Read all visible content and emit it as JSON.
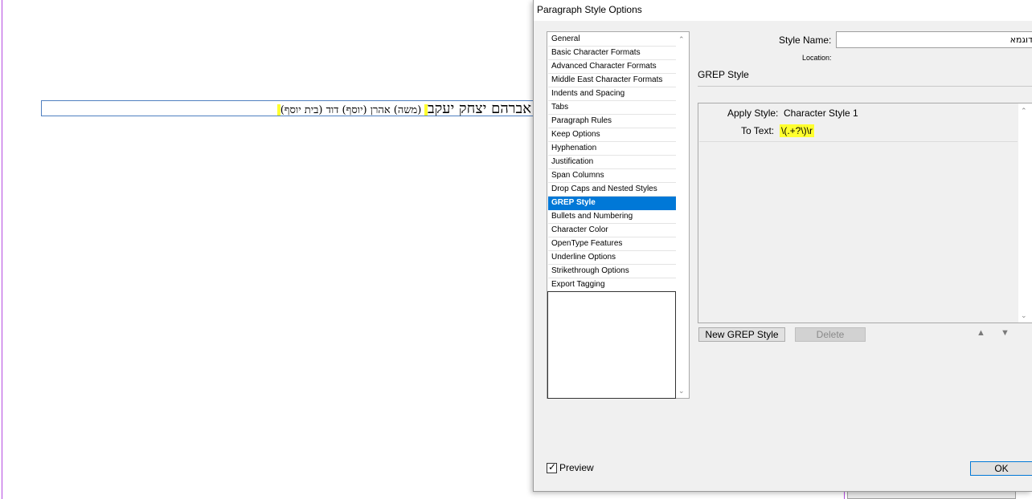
{
  "document": {
    "line_part1": "אברהם יצחק יעקב",
    "line_part2": "(משה) אהרן (יוסף) דוד (בית יוסף)"
  },
  "dialog": {
    "title": "Paragraph Style Options",
    "categories": [
      "General",
      "Basic Character Formats",
      "Advanced Character Formats",
      "Middle East Character Formats",
      "Indents and Spacing",
      "Tabs",
      "Paragraph Rules",
      "Keep Options",
      "Hyphenation",
      "Justification",
      "Span Columns",
      "Drop Caps and Nested Styles",
      "GREP Style",
      "Bullets and Numbering",
      "Character Color",
      "OpenType Features",
      "Underline Options",
      "Strikethrough Options",
      "Export Tagging"
    ],
    "selected_category": "GREP Style",
    "style_name_label": "Style Name:",
    "style_name_value": "דוגמא",
    "location_label": "Location:",
    "section_title": "GREP Style",
    "grep": {
      "apply_style_label": "Apply Style:",
      "apply_style_value": "Character Style 1",
      "to_text_label": "To Text:",
      "to_text_value": "\\(.+?\\)\\r"
    },
    "buttons": {
      "new_grep_style": "New GREP Style",
      "delete": "Delete",
      "ok": "OK"
    },
    "preview_label": "Preview",
    "preview_checked": true
  },
  "colors": {
    "highlight": "#ffff2e",
    "selection": "#0078d7",
    "frame_border": "#4f7fc0",
    "guide": "#b44be0"
  }
}
